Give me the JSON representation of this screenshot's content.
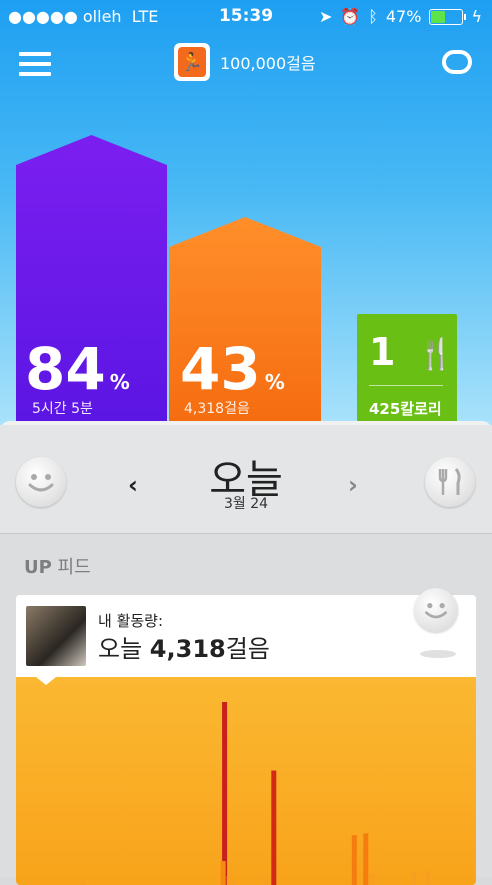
{
  "status": {
    "carrier": "●●●●● olleh",
    "network": "LTE",
    "time": "15:39",
    "battery": "47%",
    "battery_level": 0.47
  },
  "header": {
    "goal": "100,000걸음"
  },
  "sleep": {
    "percent": "84",
    "unit": "%",
    "detail": "5시간 5분"
  },
  "steps": {
    "percent": "43",
    "unit": "%",
    "detail": "4,318걸음"
  },
  "food": {
    "count": "1",
    "calories": "425칼로리"
  },
  "day": {
    "title": "오늘",
    "date": "3월 24"
  },
  "feed": {
    "label_bold": "UP",
    "label_rest": " 피드"
  },
  "card": {
    "label": "내 활동량:",
    "prefix": "오늘 ",
    "value": "4,318",
    "suffix": "걸음"
  },
  "chart_data": {
    "type": "bar",
    "series": [
      {
        "values": [
          0,
          0,
          0,
          0,
          0,
          0,
          0,
          0,
          0,
          0,
          0,
          0,
          0,
          0,
          0,
          0,
          0,
          0,
          0,
          0,
          0,
          0,
          0,
          0,
          0,
          0,
          0,
          0,
          0,
          0,
          0,
          0,
          0,
          0,
          0,
          0,
          0,
          0,
          0,
          0,
          0,
          0,
          0,
          0,
          0,
          0,
          0,
          0,
          0,
          0,
          0,
          0,
          0,
          0,
          0,
          0,
          0,
          0,
          0,
          0,
          0,
          0,
          0,
          0,
          0,
          0,
          0,
          0,
          0,
          0,
          0,
          0,
          0,
          0,
          0,
          0,
          0,
          0,
          0,
          0,
          0,
          0,
          0,
          0,
          0,
          0,
          0,
          0,
          0,
          0,
          0,
          0,
          0,
          0,
          0,
          0,
          0,
          0,
          0,
          0
        ]
      }
    ],
    "bars": [
      {
        "t": 0.448,
        "v": 1.0,
        "color": "#c9201c"
      },
      {
        "t": 0.555,
        "v": 0.63,
        "color": "#d32a16"
      },
      {
        "t": 0.445,
        "v": 0.14,
        "color": "#f58a10"
      },
      {
        "t": 0.458,
        "v": 0.06,
        "color": "#f7a020"
      },
      {
        "t": 0.47,
        "v": 0.03,
        "color": "#f7a020"
      },
      {
        "t": 0.538,
        "v": 0.05,
        "color": "#f7a020"
      },
      {
        "t": 0.73,
        "v": 0.28,
        "color": "#f57d0f"
      },
      {
        "t": 0.755,
        "v": 0.29,
        "color": "#f57d0f"
      },
      {
        "t": 0.77,
        "v": 0.07,
        "color": "#f7a020"
      },
      {
        "t": 0.86,
        "v": 0.08,
        "color": "#f7a020"
      },
      {
        "t": 0.89,
        "v": 0.09,
        "color": "#f7a020"
      },
      {
        "t": 0.14,
        "v": 0.02,
        "color": "#f7a020"
      }
    ]
  }
}
